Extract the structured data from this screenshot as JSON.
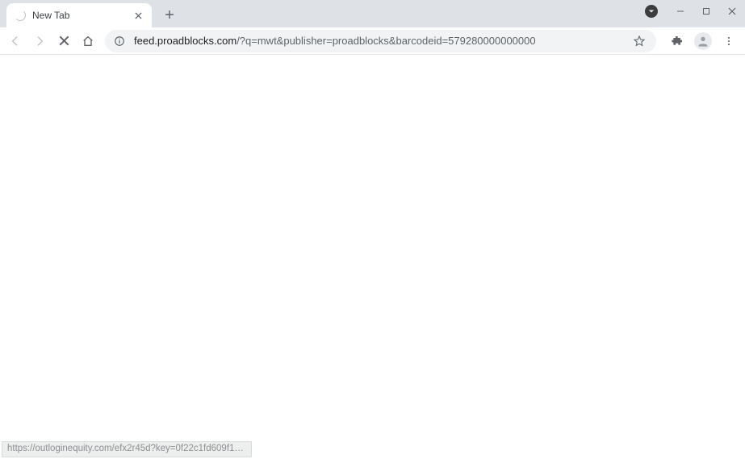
{
  "tab": {
    "title": "New Tab"
  },
  "address": {
    "host": "feed.proadblocks.com",
    "path": "/?q=mwt&publisher=proadblocks&barcodeid=579280000000000"
  },
  "statusbar": {
    "text": "https://outloginequity.com/efx2r45d?key=0f22c1fd609f13cb7947c8cab..."
  }
}
